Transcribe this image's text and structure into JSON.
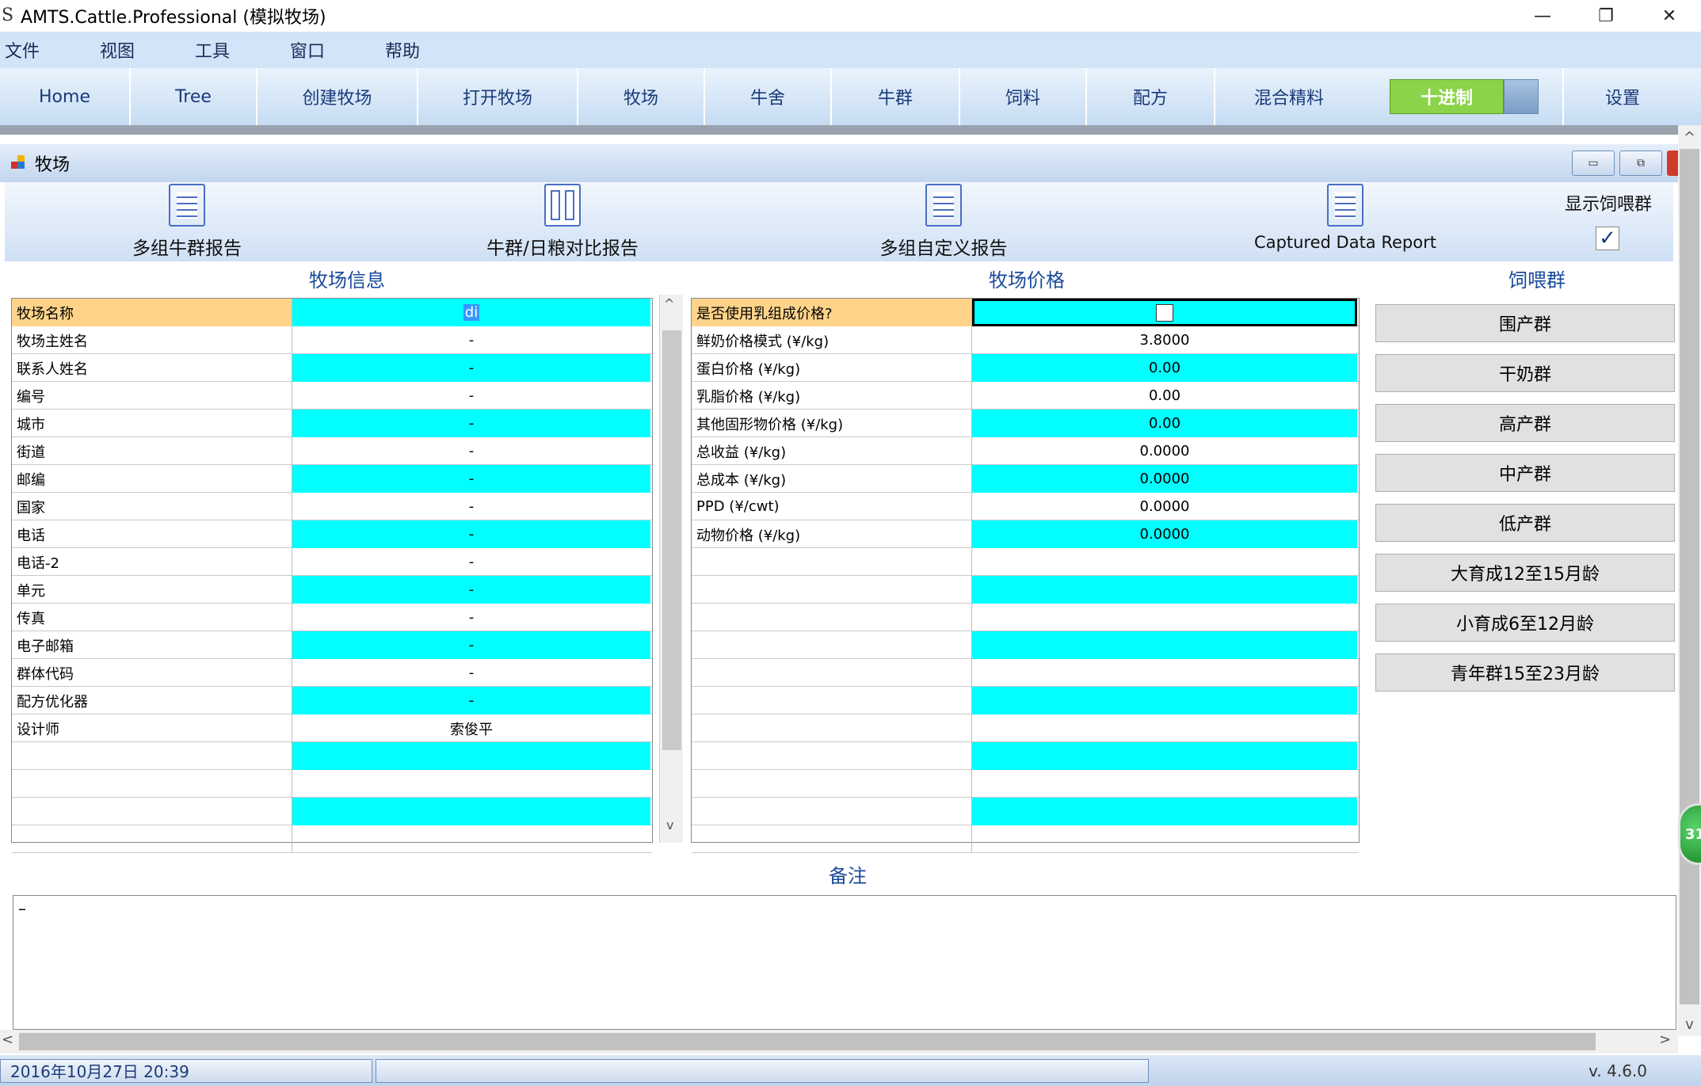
{
  "window": {
    "app_icon": "S",
    "title": "AMTS.Cattle.Professional (模拟牧场)",
    "minimize": "—",
    "restore": "❐",
    "close": "✕"
  },
  "menu": [
    "文件",
    "视图",
    "工具",
    "窗口",
    "帮助"
  ],
  "tabs": [
    {
      "label": "Home",
      "active": false
    },
    {
      "label": "Tree",
      "active": false
    },
    {
      "label": "创建牧场",
      "active": false
    },
    {
      "label": "打开牧场",
      "active": false
    },
    {
      "label": "牧场",
      "active": false
    },
    {
      "label": "牛舍",
      "active": false
    },
    {
      "label": "牛群",
      "active": false
    },
    {
      "label": "饲料",
      "active": false
    },
    {
      "label": "配方",
      "active": false
    },
    {
      "label": "混合精料",
      "active": false
    },
    {
      "label": "十进制",
      "active": true
    },
    {
      "label": "设置",
      "active": false
    }
  ],
  "child_window": {
    "title": "牧场",
    "btn_minimize": "▭",
    "btn_restore": "⧉"
  },
  "toolbar": {
    "multi_group_report": "多组牛群报告",
    "herd_ration_compare": "牛群/日粮对比报告",
    "multi_custom_report": "多组自定义报告",
    "captured_data_report": "Captured Data Report",
    "show_feeding_groups": "显示饲喂群",
    "show_feeding_groups_checked": true,
    "check_mark": "✓"
  },
  "sections": {
    "farm_info": "牧场信息",
    "farm_price": "牧场价格",
    "feeding_groups": "饲喂群",
    "notes": "备注"
  },
  "farm_info": [
    {
      "label": "牧场名称",
      "value": "di"
    },
    {
      "label": "牧场主姓名",
      "value": "-"
    },
    {
      "label": "联系人姓名",
      "value": "-"
    },
    {
      "label": "编号",
      "value": "-"
    },
    {
      "label": "城市",
      "value": "-"
    },
    {
      "label": "街道",
      "value": "-"
    },
    {
      "label": "邮编",
      "value": "-"
    },
    {
      "label": "国家",
      "value": "-"
    },
    {
      "label": "电话",
      "value": "-"
    },
    {
      "label": "电话-2",
      "value": "-"
    },
    {
      "label": "单元",
      "value": "-"
    },
    {
      "label": "传真",
      "value": "-"
    },
    {
      "label": "电子邮箱",
      "value": "-"
    },
    {
      "label": "群体代码",
      "value": "-"
    },
    {
      "label": "配方优化器",
      "value": "-"
    },
    {
      "label": "设计师",
      "value": "索俊平"
    },
    {
      "label": "",
      "value": ""
    },
    {
      "label": "",
      "value": ""
    },
    {
      "label": "",
      "value": ""
    },
    {
      "label": "",
      "value": ""
    }
  ],
  "farm_price": [
    {
      "label": "是否使用乳组成价格?",
      "value": ""
    },
    {
      "label": "鲜奶价格模式 (¥/kg)",
      "value": "3.8000"
    },
    {
      "label": "蛋白价格 (¥/kg)",
      "value": "0.00"
    },
    {
      "label": "乳脂价格 (¥/kg)",
      "value": "0.00"
    },
    {
      "label": "其他固形物价格 (¥/kg)",
      "value": "0.00"
    },
    {
      "label": "总收益 (¥/kg)",
      "value": "0.0000"
    },
    {
      "label": "总成本 (¥/kg)",
      "value": "0.0000"
    },
    {
      "label": "PPD (¥/cwt)",
      "value": "0.0000"
    },
    {
      "label": "动物价格 (¥/kg)",
      "value": "0.0000"
    },
    {
      "label": "",
      "value": ""
    },
    {
      "label": "",
      "value": ""
    },
    {
      "label": "",
      "value": ""
    },
    {
      "label": "",
      "value": ""
    },
    {
      "label": "",
      "value": ""
    },
    {
      "label": "",
      "value": ""
    },
    {
      "label": "",
      "value": ""
    },
    {
      "label": "",
      "value": ""
    },
    {
      "label": "",
      "value": ""
    },
    {
      "label": "",
      "value": ""
    },
    {
      "label": "",
      "value": ""
    }
  ],
  "feeding_groups": [
    "围产群",
    "干奶群",
    "高产群",
    "中产群",
    "低产群",
    "大育成12至15月龄",
    "小育成6至12月龄",
    "青年群15至23月龄"
  ],
  "notes_text": "–",
  "status": {
    "datetime": "2016年10月27日   20:39",
    "version": "v. 4.6.0"
  },
  "badge": "31",
  "scroll_arrows": {
    "up": "^",
    "down": "v",
    "left": "<",
    "right": ">"
  }
}
